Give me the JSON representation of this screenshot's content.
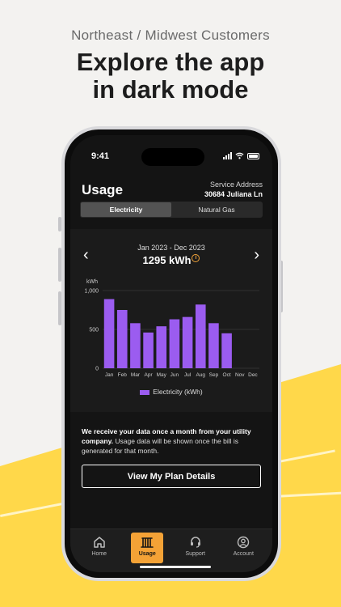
{
  "promo": {
    "subtitle": "Northeast / Midwest Customers",
    "title_line1": "Explore the app",
    "title_line2": "in dark mode"
  },
  "status_bar": {
    "time": "9:41"
  },
  "header": {
    "title": "Usage",
    "service_address_label": "Service Address",
    "service_address_value": "30684 Juliana Ln"
  },
  "tabs": [
    {
      "label": "Electricity",
      "active": true
    },
    {
      "label": "Natural Gas",
      "active": false
    }
  ],
  "period": {
    "range": "Jan 2023 - Dec 2023",
    "total": "1295 kWh"
  },
  "chart_data": {
    "type": "bar",
    "categories": [
      "Jan",
      "Feb",
      "Mar",
      "Apr",
      "May",
      "Jun",
      "Jul",
      "Aug",
      "Sep",
      "Oct",
      "Nov",
      "Dec"
    ],
    "series": [
      {
        "name": "Electricity (kWh)",
        "values": [
          890,
          750,
          580,
          460,
          540,
          630,
          660,
          820,
          580,
          450,
          null,
          null
        ],
        "color": "#9b5cf0"
      }
    ],
    "ylabel": "kWh",
    "yticks": [
      "0",
      "500",
      "1,000"
    ],
    "ylim": [
      0,
      1000
    ],
    "grid": true,
    "legend": "bottom"
  },
  "notice": {
    "bold": "We receive your data once a month from your utility company.",
    "text": " Usage data will be shown once the bill is generated for that month."
  },
  "buttons": {
    "plan_details": "View My Plan Details"
  },
  "nav": [
    {
      "label": "Home",
      "icon": "home-icon",
      "active": false
    },
    {
      "label": "Usage",
      "icon": "usage-icon",
      "active": true
    },
    {
      "label": "Support",
      "icon": "headset-icon",
      "active": false
    },
    {
      "label": "Account",
      "icon": "account-icon",
      "active": false
    }
  ],
  "colors": {
    "accent": "#f4a236",
    "bar": "#9b5cf0",
    "brand_yellow": "#ffd84a"
  }
}
